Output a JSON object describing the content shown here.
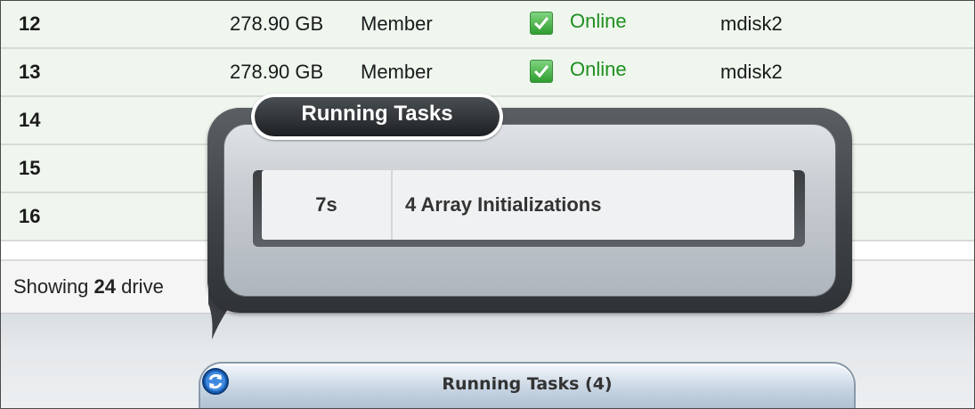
{
  "drives": {
    "rows": [
      {
        "id": "12",
        "capacity": "278.90 GB",
        "use": "Member",
        "status": "Online",
        "mdisk": "mdisk2"
      },
      {
        "id": "13",
        "capacity": "278.90 GB",
        "use": "Member",
        "status": "Online",
        "mdisk": "mdisk2"
      },
      {
        "id": "14"
      },
      {
        "id": "15"
      },
      {
        "id": "16"
      }
    ]
  },
  "footer": {
    "prefix": "Showing",
    "count": "24",
    "suffix": "drive"
  },
  "running_tasks_popup": {
    "title": "Running Tasks",
    "tasks": [
      {
        "elapsed": "7s",
        "description": "4 Array Initializations"
      }
    ]
  },
  "status_bar": {
    "running_tasks_label": "Running Tasks (4)"
  },
  "colors": {
    "status_online": "#1f8f1f",
    "row_background": "#eef6ee",
    "popup_frame": "#3f4347"
  },
  "icons": {
    "status_check": "check-icon",
    "refresh": "refresh-icon"
  }
}
